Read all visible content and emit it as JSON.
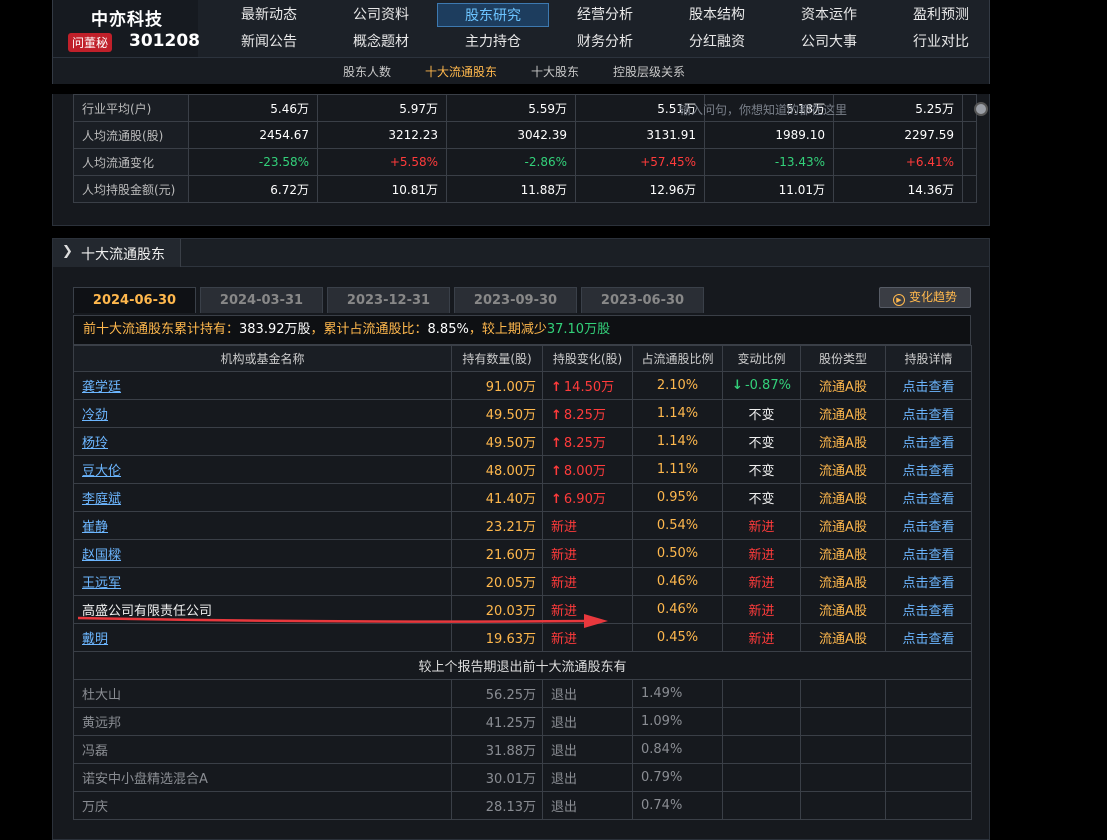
{
  "header": {
    "company_name": "中亦科技",
    "badge": "问董秘",
    "stock_code": "301208",
    "nav_row1": [
      "最新动态",
      "公司资料",
      "股东研究",
      "经营分析",
      "股本结构",
      "资本运作",
      "盈利预测"
    ],
    "nav_row2": [
      "新闻公告",
      "概念题材",
      "主力持仓",
      "财务分析",
      "分红融资",
      "公司大事",
      "行业对比"
    ],
    "active_nav": "股东研究",
    "subnav": [
      "股东人数",
      "十大流通股东",
      "十大股东",
      "控股层级关系"
    ],
    "active_subnav": "十大流通股东"
  },
  "summary_panel": {
    "search_ghost": "输入问句，你想知道的都在这里",
    "rows": [
      {
        "label": "行业平均(户)",
        "values": [
          "5.46万",
          "5.97万",
          "5.59万",
          "5.51万",
          "5.18万",
          "5.25万"
        ],
        "dirs": [
          "",
          "",
          "",
          "",
          "",
          ""
        ]
      },
      {
        "label": "人均流通股(股)",
        "values": [
          "2454.67",
          "3212.23",
          "3042.39",
          "3131.91",
          "1989.10",
          "2297.59"
        ],
        "dirs": [
          "",
          "",
          "",
          "",
          "",
          ""
        ]
      },
      {
        "label": "人均流通变化",
        "values": [
          "-23.58%",
          "+5.58%",
          "-2.86%",
          "+57.45%",
          "-13.43%",
          "+6.41%"
        ],
        "dirs": [
          "neg",
          "pos",
          "neg",
          "pos",
          "neg",
          "pos"
        ]
      },
      {
        "label": "人均持股金额(元)",
        "values": [
          "6.72万",
          "10.81万",
          "11.88万",
          "12.96万",
          "11.01万",
          "14.36万"
        ],
        "dirs": [
          "",
          "",
          "",
          "",
          "",
          ""
        ]
      }
    ]
  },
  "section": {
    "title": "十大流通股东",
    "tabs": [
      "2024-06-30",
      "2024-03-31",
      "2023-12-31",
      "2023-09-30",
      "2023-06-30"
    ],
    "active_tab": "2024-06-30",
    "trend_button": "变化趋势",
    "summary": {
      "prefix": "前十大流通股东累计持有：",
      "total": "383.92万股",
      "mid": "，累计占流通股比：",
      "ratio": "8.85%",
      "suffix": "，较上期减少",
      "change": "37.10万股"
    },
    "columns": [
      "机构或基金名称",
      "持有数量(股)",
      "持股变化(股)",
      "占流通股比例",
      "变动比例",
      "股份类型",
      "持股详情"
    ],
    "rows": [
      {
        "name": "龚学廷",
        "link": true,
        "amount": "91.00万",
        "change": "14.50万",
        "change_dir": "up",
        "ratio": "2.10%",
        "vr": "-0.87%",
        "vr_dir": "down",
        "type": "流通A股",
        "detail": "点击查看"
      },
      {
        "name": "冷劲",
        "link": true,
        "amount": "49.50万",
        "change": "8.25万",
        "change_dir": "up",
        "ratio": "1.14%",
        "vr": "不变",
        "vr_dir": "neutral",
        "type": "流通A股",
        "detail": "点击查看"
      },
      {
        "name": "杨玲",
        "link": true,
        "amount": "49.50万",
        "change": "8.25万",
        "change_dir": "up",
        "ratio": "1.14%",
        "vr": "不变",
        "vr_dir": "neutral",
        "type": "流通A股",
        "detail": "点击查看"
      },
      {
        "name": "豆大伦",
        "link": true,
        "amount": "48.00万",
        "change": "8.00万",
        "change_dir": "up",
        "ratio": "1.11%",
        "vr": "不变",
        "vr_dir": "neutral",
        "type": "流通A股",
        "detail": "点击查看"
      },
      {
        "name": "李庭斌",
        "link": true,
        "amount": "41.40万",
        "change": "6.90万",
        "change_dir": "up",
        "ratio": "0.95%",
        "vr": "不变",
        "vr_dir": "neutral",
        "type": "流通A股",
        "detail": "点击查看"
      },
      {
        "name": "崔静",
        "link": true,
        "amount": "23.21万",
        "change": "新进",
        "change_dir": "new",
        "ratio": "0.54%",
        "vr": "新进",
        "vr_dir": "new",
        "type": "流通A股",
        "detail": "点击查看"
      },
      {
        "name": "赵国樑",
        "link": true,
        "amount": "21.60万",
        "change": "新进",
        "change_dir": "new",
        "ratio": "0.50%",
        "vr": "新进",
        "vr_dir": "new",
        "type": "流通A股",
        "detail": "点击查看"
      },
      {
        "name": "王远军",
        "link": true,
        "amount": "20.05万",
        "change": "新进",
        "change_dir": "new",
        "ratio": "0.46%",
        "vr": "新进",
        "vr_dir": "new",
        "type": "流通A股",
        "detail": "点击查看"
      },
      {
        "name": "高盛公司有限责任公司",
        "link": false,
        "amount": "20.03万",
        "change": "新进",
        "change_dir": "new",
        "ratio": "0.46%",
        "vr": "新进",
        "vr_dir": "new",
        "type": "流通A股",
        "detail": "点击查看"
      },
      {
        "name": "戴明",
        "link": true,
        "amount": "19.63万",
        "change": "新进",
        "change_dir": "new",
        "ratio": "0.45%",
        "vr": "新进",
        "vr_dir": "new",
        "type": "流通A股",
        "detail": "点击查看"
      }
    ],
    "exit_title": "较上个报告期退出前十大流通股东有",
    "exit_rows": [
      {
        "name": "杜大山",
        "amount": "56.25万",
        "change": "退出",
        "ratio": "1.49%"
      },
      {
        "name": "黄远邦",
        "amount": "41.25万",
        "change": "退出",
        "ratio": "1.09%"
      },
      {
        "name": "冯磊",
        "amount": "31.88万",
        "change": "退出",
        "ratio": "0.84%"
      },
      {
        "name": "诺安中小盘精选混合A",
        "amount": "30.01万",
        "change": "退出",
        "ratio": "0.79%"
      },
      {
        "name": "万庆",
        "amount": "28.13万",
        "change": "退出",
        "ratio": "0.74%"
      }
    ]
  },
  "colors": {
    "accent_orange": "#ffb84d",
    "up_red": "#ff3b3b",
    "down_green": "#33d17a",
    "link_blue": "#6cb6ff",
    "annotation_arrow": "#e8383d"
  }
}
